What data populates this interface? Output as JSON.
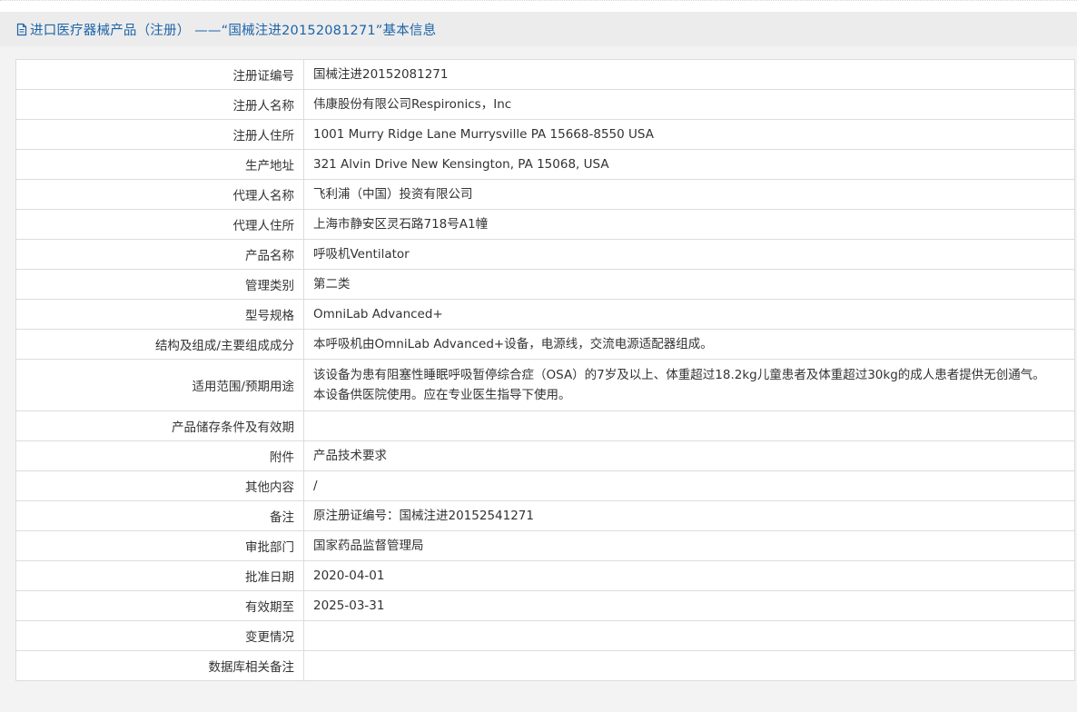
{
  "header": {
    "title": "进口医疗器械产品（注册） ——“国械注进20152081271”基本信息"
  },
  "rows": [
    {
      "label": "注册证编号",
      "value": "国械注进20152081271"
    },
    {
      "label": "注册人名称",
      "value": "伟康股份有限公司Respironics，Inc"
    },
    {
      "label": "注册人住所",
      "value": "1001 Murry Ridge Lane Murrysville PA 15668-8550 USA"
    },
    {
      "label": "生产地址",
      "value": "321 Alvin Drive New Kensington, PA 15068, USA"
    },
    {
      "label": "代理人名称",
      "value": "飞利浦（中国）投资有限公司"
    },
    {
      "label": "代理人住所",
      "value": "上海市静安区灵石路718号A1幢"
    },
    {
      "label": "产品名称",
      "value": "呼吸机Ventilator"
    },
    {
      "label": "管理类别",
      "value": "第二类"
    },
    {
      "label": "型号规格",
      "value": "OmniLab Advanced+"
    },
    {
      "label": "结构及组成/主要组成成分",
      "value": "本呼吸机由OmniLab Advanced+设备，电源线，交流电源适配器组成。"
    },
    {
      "label": "适用范围/预期用途",
      "value": "该设备为患有阻塞性睡眠呼吸暂停综合症（OSA）的7岁及以上、体重超过18.2kg儿童患者及体重超过30kg的成人患者提供无创通气。本设备供医院使用。应在专业医生指导下使用。"
    },
    {
      "label": "产品储存条件及有效期",
      "value": ""
    },
    {
      "label": "附件",
      "value": "产品技术要求"
    },
    {
      "label": "其他内容",
      "value": "/"
    },
    {
      "label": "备注",
      "value": "原注册证编号：国械注进20152541271"
    },
    {
      "label": "审批部门",
      "value": "国家药品监督管理局"
    },
    {
      "label": "批准日期",
      "value": "2020-04-01"
    },
    {
      "label": "有效期至",
      "value": "2025-03-31"
    },
    {
      "label": "变更情况",
      "value": ""
    },
    {
      "label": "数据库相关备注",
      "value": ""
    }
  ]
}
